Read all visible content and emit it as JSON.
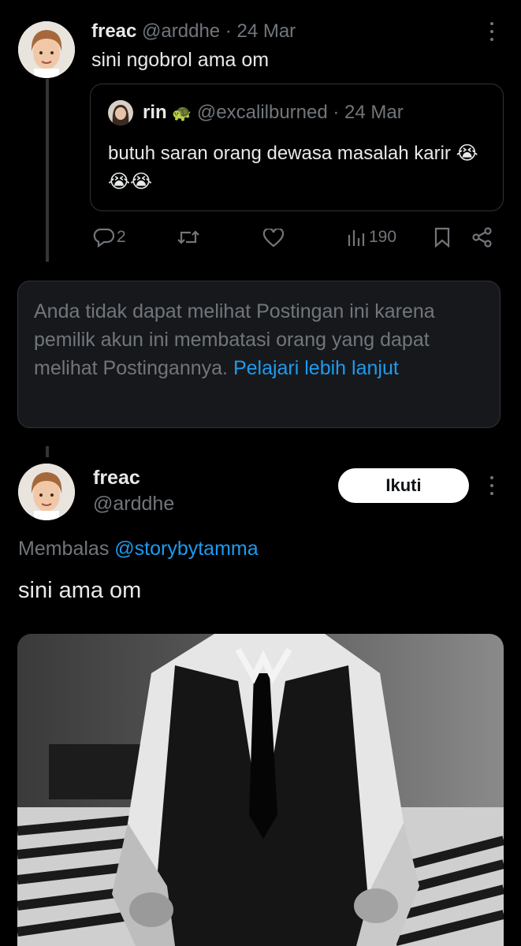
{
  "tweet1": {
    "name": "freac",
    "handle": "@arddhe",
    "sep": " · ",
    "date": "24 Mar",
    "text": "sini ngobrol ama om",
    "quote": {
      "name": "rin",
      "emoji": "🐢",
      "handle": "@excalilburned",
      "date": "24 Mar",
      "text": "butuh saran orang dewasa masalah karir",
      "emojis": "😭😭😭"
    },
    "actions": {
      "replies": "2",
      "views": "190"
    }
  },
  "notice": {
    "text": "Anda tidak dapat melihat Postingan ini karena pemilik akun ini membatasi orang yang dapat melihat Postingannya.",
    "link": "Pelajari lebih lanjut"
  },
  "tweet2": {
    "name": "freac",
    "handle": "@arddhe",
    "follow_label": "Ikuti",
    "reply_prefix": "Membalas ",
    "reply_to": "@storybytamma",
    "text": "sini ama om"
  },
  "icons": {
    "reply": "reply-icon",
    "retweet": "retweet-icon",
    "like": "heart-icon",
    "views": "views-icon",
    "bookmark": "bookmark-icon",
    "share": "share-icon",
    "more": "more-icon"
  },
  "colors": {
    "background": "#000000",
    "text": "#e7e9ea",
    "muted": "#71767b",
    "link": "#1d9bf0",
    "border": "#2f3336"
  }
}
